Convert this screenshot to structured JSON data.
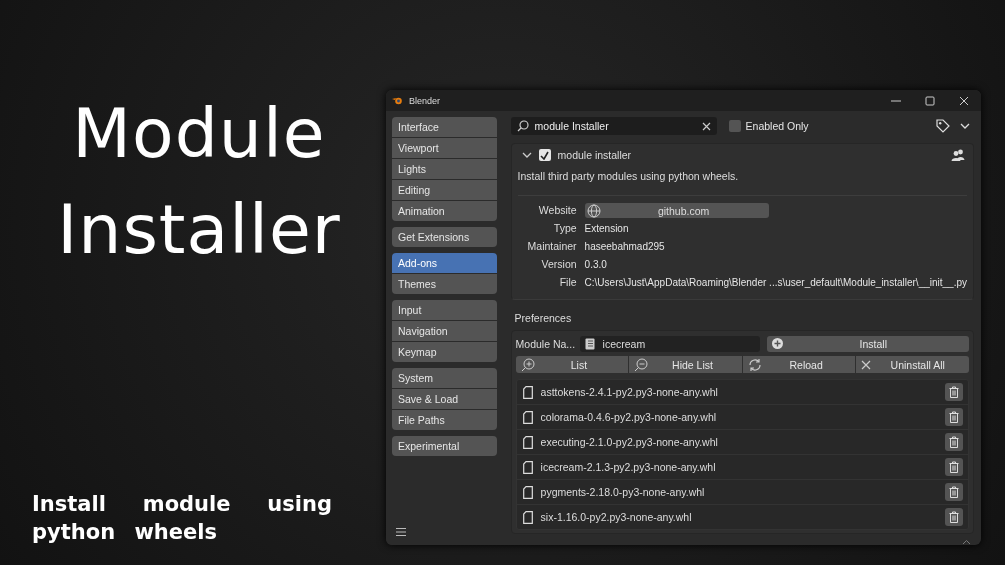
{
  "poster": {
    "title_lines": [
      "Module",
      "Installer"
    ],
    "subtitle": "Install module using python wheels"
  },
  "window": {
    "title": "Blender"
  },
  "sidebar": {
    "groups": [
      {
        "items": [
          {
            "label": "Interface",
            "selected": false
          },
          {
            "label": "Viewport",
            "selected": false
          },
          {
            "label": "Lights",
            "selected": false
          },
          {
            "label": "Editing",
            "selected": false
          },
          {
            "label": "Animation",
            "selected": false
          }
        ]
      },
      {
        "items": [
          {
            "label": "Get Extensions",
            "selected": false
          }
        ]
      },
      {
        "items": [
          {
            "label": "Add-ons",
            "selected": true
          },
          {
            "label": "Themes",
            "selected": false
          }
        ]
      },
      {
        "items": [
          {
            "label": "Input",
            "selected": false
          },
          {
            "label": "Navigation",
            "selected": false
          },
          {
            "label": "Keymap",
            "selected": false
          }
        ]
      },
      {
        "items": [
          {
            "label": "System",
            "selected": false
          },
          {
            "label": "Save & Load",
            "selected": false
          },
          {
            "label": "File Paths",
            "selected": false
          }
        ]
      },
      {
        "items": [
          {
            "label": "Experimental",
            "selected": false
          }
        ]
      }
    ]
  },
  "search": {
    "value": "module Installer"
  },
  "enabled_only": {
    "label": "Enabled Only",
    "checked": false
  },
  "addon": {
    "name": "module installer",
    "expanded": true,
    "enabled": true,
    "description": "Install third party modules using python wheels.",
    "details": [
      {
        "label": "Website",
        "value": "github.com",
        "kind": "link"
      },
      {
        "label": "Type",
        "value": "Extension",
        "kind": "text"
      },
      {
        "label": "Maintainer",
        "value": "haseebahmad295",
        "kind": "text"
      },
      {
        "label": "Version",
        "value": "0.3.0",
        "kind": "text"
      },
      {
        "label": "File",
        "value": "C:\\Users\\Just\\AppData\\Roaming\\Blender ...s\\user_default\\Module_installer\\__init__.py",
        "kind": "text"
      }
    ]
  },
  "preferences": {
    "title": "Preferences",
    "module_label": "Module Na...",
    "module_value": "icecream",
    "install": "Install",
    "actions": [
      {
        "label": "List",
        "kind": "zoom-in"
      },
      {
        "label": "Hide List",
        "kind": "zoom-out"
      },
      {
        "label": "Reload",
        "kind": "reload"
      },
      {
        "label": "Uninstall All",
        "kind": "close"
      }
    ],
    "wheels": [
      "asttokens-2.4.1-py2.py3-none-any.whl",
      "colorama-0.4.6-py2.py3-none-any.whl",
      "executing-2.1.0-py2.py3-none-any.whl",
      "icecream-2.1.3-py2.py3-none-any.whl",
      "pygments-2.18.0-py3-none-any.whl",
      "six-1.16.0-py2.py3-none-any.whl"
    ]
  }
}
